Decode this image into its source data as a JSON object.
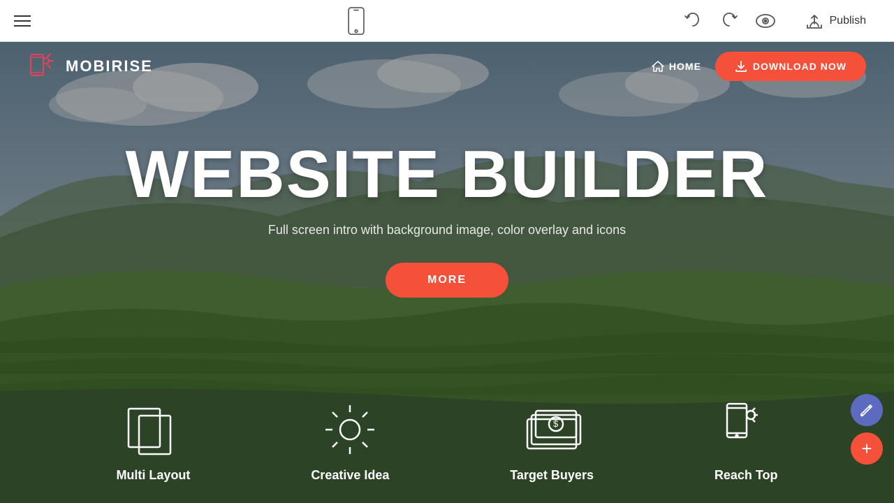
{
  "toolbar": {
    "hamburger_label": "menu",
    "undo_label": "undo",
    "redo_label": "redo",
    "preview_label": "preview",
    "publish_label": "Publish",
    "phone_label": "mobile preview"
  },
  "navbar": {
    "logo_text": "MOBIRISE",
    "home_label": "HOME",
    "download_label": "DOWNLOAD NOW"
  },
  "hero": {
    "title": "WEBSITE BUILDER",
    "subtitle": "Full screen intro with background image, color overlay and icons",
    "more_button": "MORE"
  },
  "features": [
    {
      "id": "multi-layout",
      "label": "Multi Layout",
      "icon": "layers"
    },
    {
      "id": "creative-idea",
      "label": "Creative Idea",
      "icon": "bulb"
    },
    {
      "id": "target-buyers",
      "label": "Target Buyers",
      "icon": "money"
    },
    {
      "id": "reach-top",
      "label": "Reach Top",
      "icon": "mobile-sun"
    }
  ],
  "colors": {
    "accent": "#f4503a",
    "nav_bg": "transparent",
    "toolbar_bg": "#ffffff"
  }
}
